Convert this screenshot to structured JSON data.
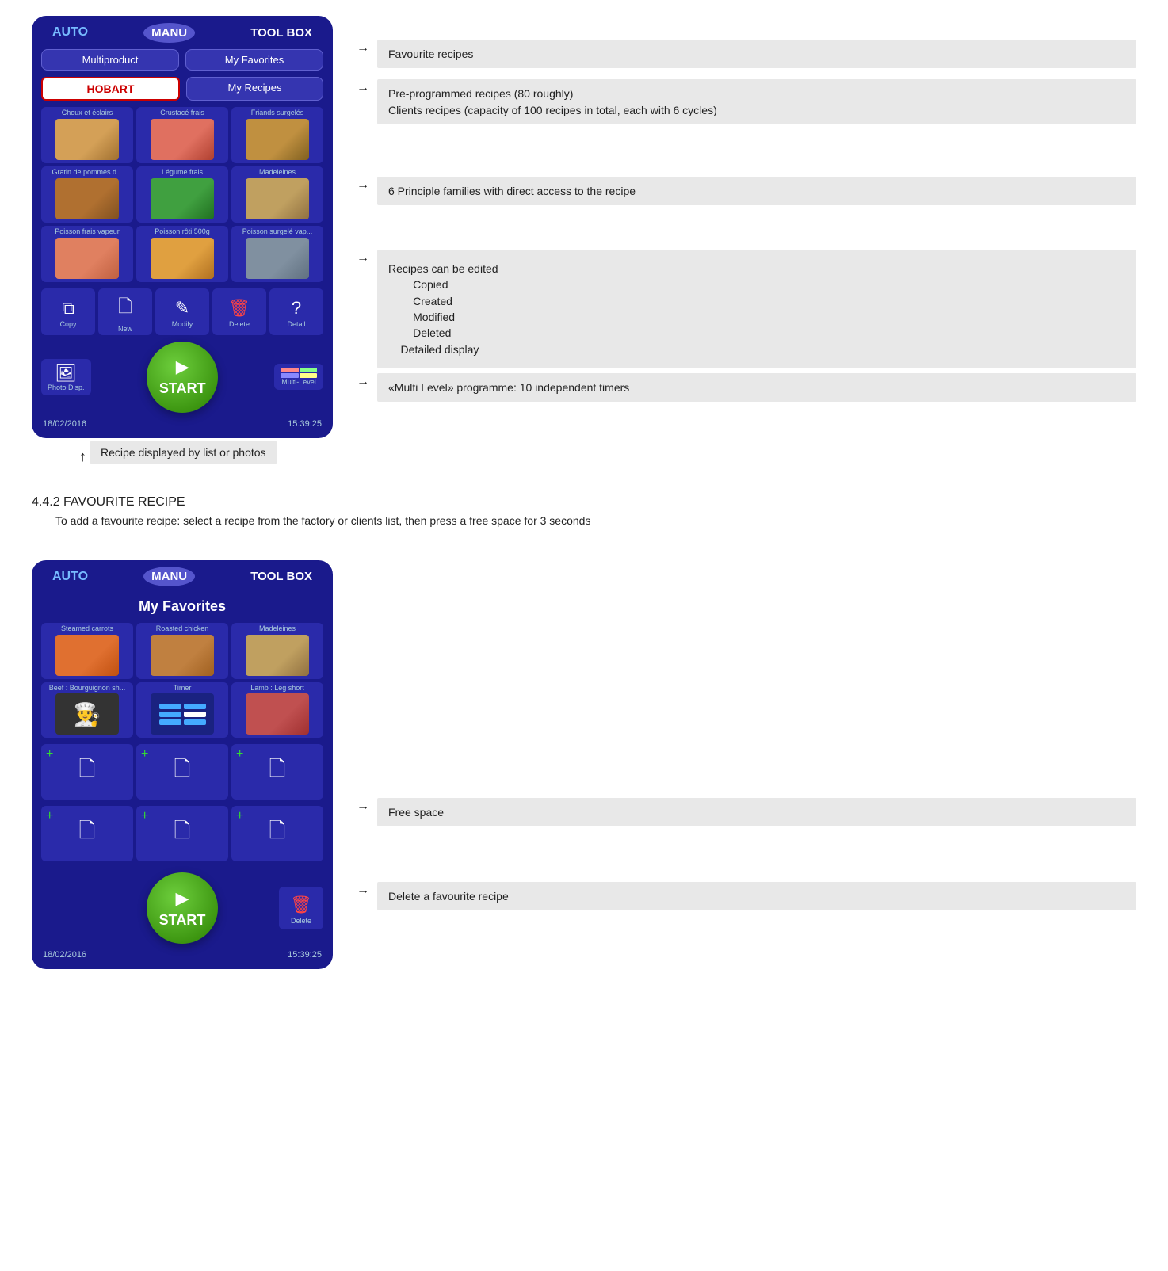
{
  "top": {
    "device": {
      "tabs": [
        "AUTO",
        "MANU",
        "TOOL BOX"
      ],
      "buttons_row1": [
        "Multiproduct",
        "My Favorites"
      ],
      "hobart_label": "HOBART",
      "my_recipes": "My Recipes",
      "grid_items": [
        {
          "label": "Choux et éclairs",
          "food": "choux"
        },
        {
          "label": "Crustacé frais",
          "food": "crustace"
        },
        {
          "label": "Friands surgelés",
          "food": "friands"
        },
        {
          "label": "Gratin de pommes d...",
          "food": "gratin"
        },
        {
          "label": "Légume frais",
          "food": "legume"
        },
        {
          "label": "Madeleines",
          "food": "madeleines"
        },
        {
          "label": "Poisson frais vapeur",
          "food": "poisson1"
        },
        {
          "label": "Poisson rôti 500g",
          "food": "poisson2"
        },
        {
          "label": "Poisson surgelé vap...",
          "food": "poisson3"
        }
      ],
      "action_btns": [
        "Copy",
        "New",
        "Modify",
        "Delete",
        "Detail"
      ],
      "photo_disp": "Photo Disp.",
      "start": "START",
      "multi_level": "Multi-Level",
      "date": "18/02/2016",
      "time": "15:39:25"
    },
    "annotations": [
      {
        "text": "Favourite recipes"
      },
      {
        "text": "Pre-programmed recipes (80 roughly)\nClients recipes (capacity of 100 recipes in total, each with 6 cycles)"
      },
      {
        "text": "6 Principle families with direct access to the recipe"
      },
      {
        "text": "Recipes can be edited\n        Copied\n        Created\n        Modified\n        Deleted\n    Detailed display"
      },
      {
        "text": "«Multi Level» programme: 10 independent timers"
      }
    ],
    "bottom_label": "Recipe displayed by list or photos"
  },
  "section": {
    "title": "4.4.2 FAVOURITE RECIPE",
    "desc": "To add a favourite recipe: select a recipe from the factory or clients list, then press a free space for 3 seconds"
  },
  "bottom": {
    "device": {
      "tabs": [
        "AUTO",
        "MANU",
        "TOOL BOX"
      ],
      "fav_title": "My Favorites",
      "fav_items": [
        {
          "label": "Steamed carrots",
          "food": "carrots"
        },
        {
          "label": "Roasted chicken",
          "food": "chicken"
        },
        {
          "label": "Madeleines",
          "food": "madeleines2"
        },
        {
          "label": "Beef : Bourguignon sh...",
          "food": "beef"
        },
        {
          "label": "Timer",
          "food": "timer"
        },
        {
          "label": "Lamb : Leg short",
          "food": "lamb"
        }
      ],
      "free_spaces": 6,
      "delete_btn": "Delete",
      "start": "START",
      "date": "18/02/2016",
      "time": "15:39:25"
    },
    "annotations": [
      {
        "text": "Free space"
      },
      {
        "text": "Delete a favourite recipe"
      }
    ]
  }
}
